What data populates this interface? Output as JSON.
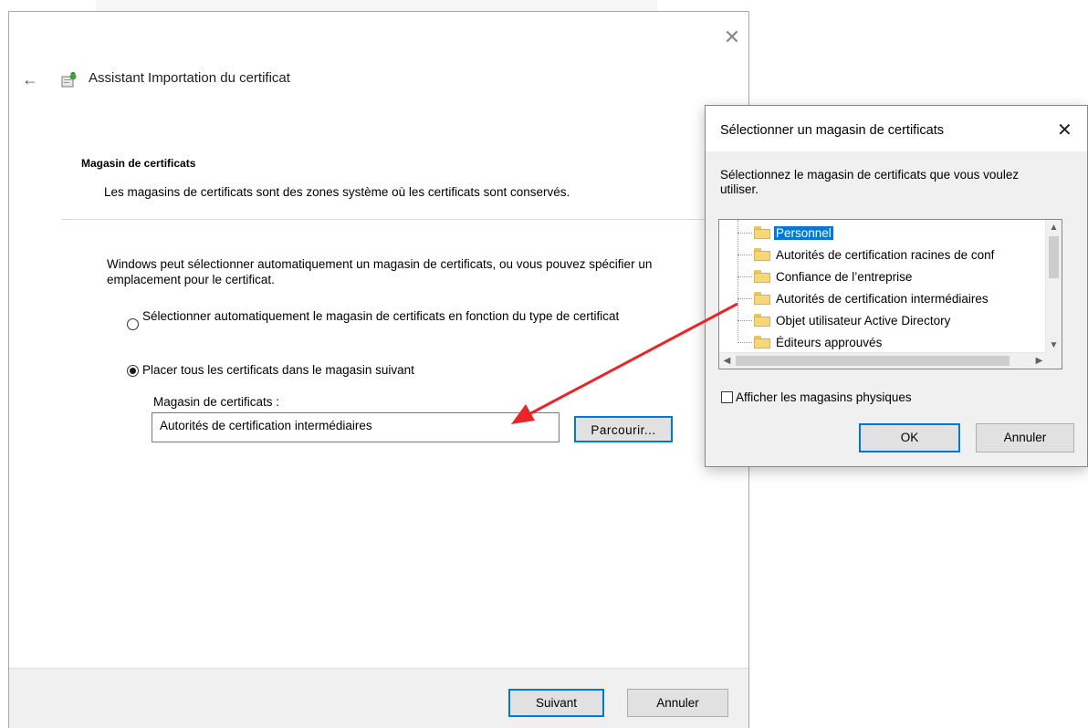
{
  "wizard": {
    "title": "Assistant Importation du certificat",
    "section_title": "Magasin de certificats",
    "section_desc": "Les magasins de certificats sont des zones système où les certificats sont conservés.",
    "intro": "Windows peut sélectionner automatiquement un magasin de certificats, ou vous pouvez spécifier un emplacement pour le certificat.",
    "radio_auto_label": "Sélectionner automatiquement le magasin de certificats en fonction du type de certificat",
    "radio_manual_label": "Placer tous les certificats dans le magasin suivant",
    "store_label": "Magasin de certificats :",
    "store_value": "Autorités de certification intermédiaires",
    "browse_label": "Parcourir...",
    "next_label": "Suivant",
    "cancel_label": "Annuler"
  },
  "dialog": {
    "title": "Sélectionner un magasin de certificats",
    "close_glyph": "✕",
    "description": "Sélectionnez le magasin de certificats que vous voulez utiliser.",
    "tree_items": [
      "Personnel",
      "Autorités de certification racines de conf",
      "Confiance de l’entreprise",
      "Autorités de certification intermédiaires",
      "Objet utilisateur Active Directory",
      "Éditeurs approuvés"
    ],
    "show_physical_label": "Afficher les magasins physiques",
    "ok_label": "OK",
    "cancel_label": "Annuler"
  },
  "colors": {
    "accent": "#0078d7",
    "annotation_arrow": "#e8262a"
  }
}
